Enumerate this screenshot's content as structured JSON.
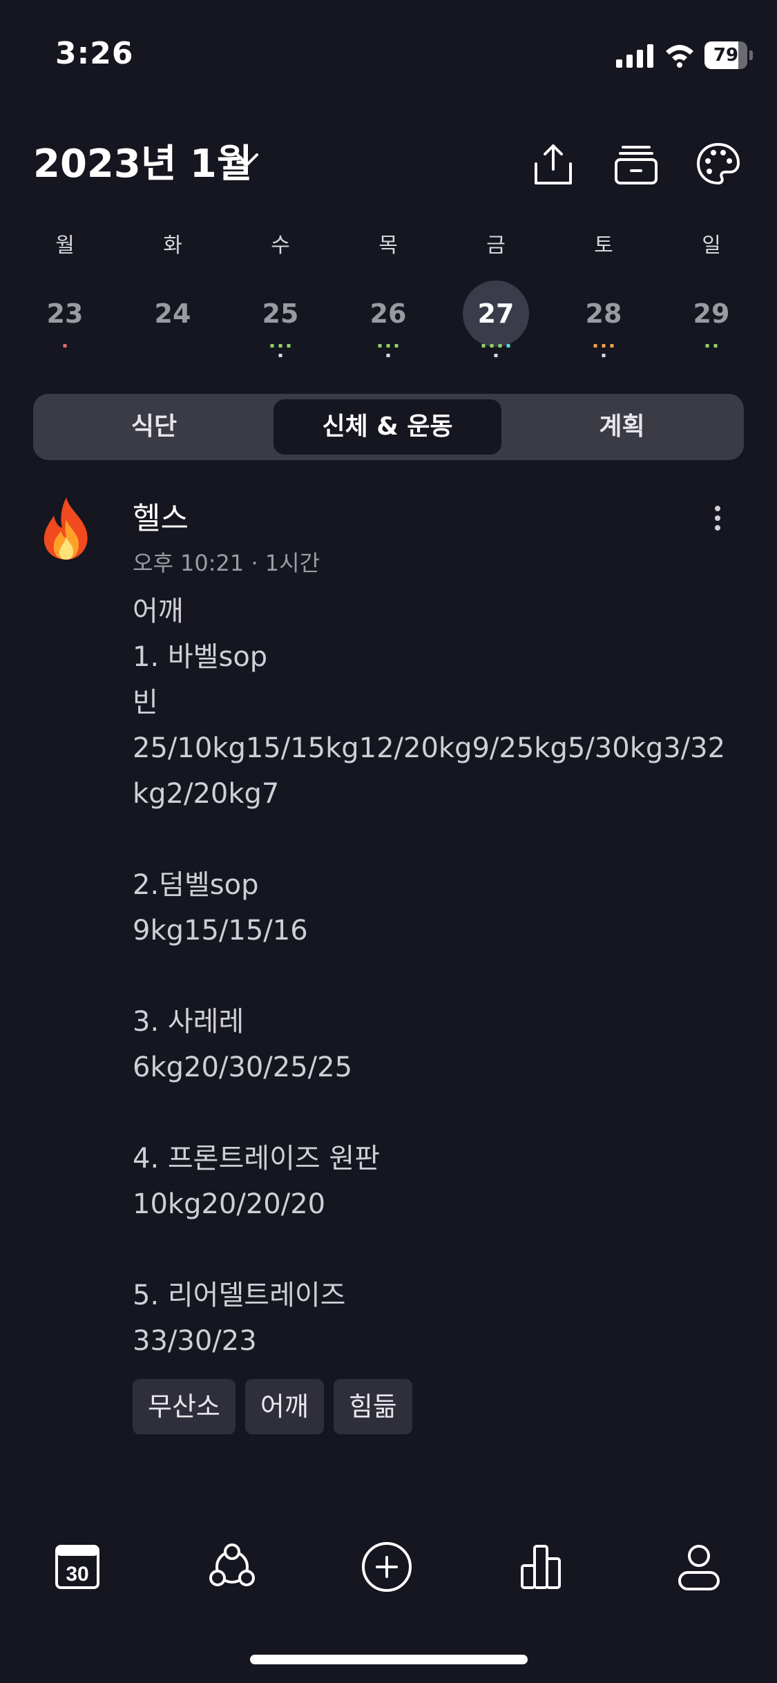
{
  "status_bar": {
    "time": "3:26",
    "battery": "79",
    "battery_level": 0.79
  },
  "header": {
    "month_title": "2023년 1월",
    "icons": [
      "chevron-down-icon",
      "share-icon",
      "archive-icon",
      "palette-icon"
    ]
  },
  "week": {
    "days": [
      {
        "dow": "월",
        "num": "23",
        "dots": [
          "#e06d6d"
        ]
      },
      {
        "dow": "화",
        "num": "24",
        "dots": []
      },
      {
        "dow": "수",
        "num": "25",
        "dots": [
          "#8fd16a",
          "#8fd16a",
          "#8fd16a",
          "#d8d9de"
        ]
      },
      {
        "dow": "목",
        "num": "26",
        "dots": [
          "#8fd16a",
          "#8fd16a",
          "#8fd16a",
          "#d8d9de"
        ]
      },
      {
        "dow": "금",
        "num": "27",
        "dots": [
          "#8fd16a",
          "#8fd16a",
          "#8fd16a",
          "#5fd6d6",
          "#d8d9de"
        ],
        "selected": true
      },
      {
        "dow": "토",
        "num": "28",
        "dots": [
          "#f0a04b",
          "#f0a04b",
          "#f0a04b",
          "#d8d9de"
        ]
      },
      {
        "dow": "일",
        "num": "29",
        "dots": [
          "#8fd16a",
          "#8fd16a"
        ]
      }
    ]
  },
  "segment": {
    "tabs": [
      "식단",
      "신체 & 운동",
      "계획"
    ],
    "active": 1
  },
  "post": {
    "icon": "fire-icon",
    "title": "헬스",
    "meta": "오후 10:21 · 1시간",
    "body": "어깨\n1. 바벨sop\n빈\n25/10kg15/15kg12/20kg9/25kg5/30kg3/32\nkg2/20kg7\n\n2.덤벨sop\n9kg15/15/16\n\n3. 사레레\n6kg20/30/25/25\n\n4. 프론트레이즈 원판\n10kg20/20/20\n\n5. 리어델트레이즈\n33/30/23",
    "tags": [
      "무산소",
      "어깨",
      "힘듦"
    ]
  },
  "tab_bar": {
    "calendar_day": "30",
    "icons": [
      "calendar-icon",
      "community-icon",
      "add-icon",
      "stats-icon",
      "profile-icon"
    ]
  },
  "colors": {
    "background": "#15161f",
    "segment_bg": "#3a3b45",
    "selected_day": "#3a3c4a",
    "tag_bg": "#2e2f3a"
  }
}
